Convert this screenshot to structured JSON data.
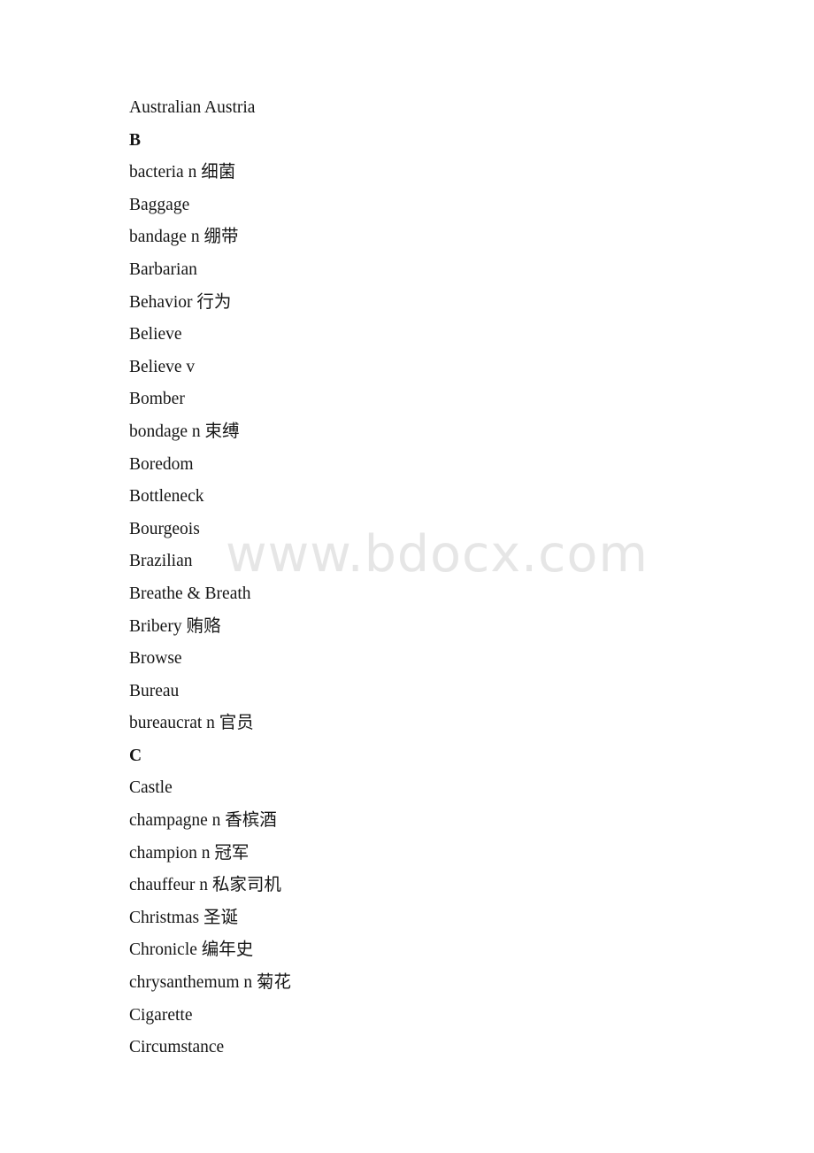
{
  "document": {
    "watermark": "www.bdocx.com",
    "entries": [
      {
        "text": "Australian Austria",
        "heading": false
      },
      {
        "text": "B",
        "heading": true
      },
      {
        "text": "bacteria n 细菌",
        "heading": false
      },
      {
        "text": "Baggage",
        "heading": false
      },
      {
        "text": "bandage n 绷带",
        "heading": false
      },
      {
        "text": "Barbarian",
        "heading": false
      },
      {
        "text": "Behavior 行为",
        "heading": false
      },
      {
        "text": "Believe",
        "heading": false
      },
      {
        "text": "Believe v",
        "heading": false
      },
      {
        "text": "Bomber",
        "heading": false
      },
      {
        "text": "bondage n 束缚",
        "heading": false
      },
      {
        "text": "Boredom",
        "heading": false
      },
      {
        "text": "Bottleneck",
        "heading": false
      },
      {
        "text": "Bourgeois",
        "heading": false
      },
      {
        "text": "Brazilian",
        "heading": false
      },
      {
        "text": "Breathe & Breath",
        "heading": false
      },
      {
        "text": "Bribery 贿赂",
        "heading": false
      },
      {
        "text": "Browse",
        "heading": false
      },
      {
        "text": "Bureau",
        "heading": false
      },
      {
        "text": "bureaucrat n 官员",
        "heading": false
      },
      {
        "text": "C",
        "heading": true
      },
      {
        "text": "Castle",
        "heading": false
      },
      {
        "text": "champagne n 香槟酒",
        "heading": false
      },
      {
        "text": "champion n 冠军",
        "heading": false
      },
      {
        "text": "chauffeur n 私家司机",
        "heading": false
      },
      {
        "text": "Christmas 圣诞",
        "heading": false
      },
      {
        "text": "Chronicle 编年史",
        "heading": false
      },
      {
        "text": "chrysanthemum n 菊花",
        "heading": false
      },
      {
        "text": "Cigarette",
        "heading": false
      },
      {
        "text": "Circumstance",
        "heading": false
      }
    ]
  }
}
